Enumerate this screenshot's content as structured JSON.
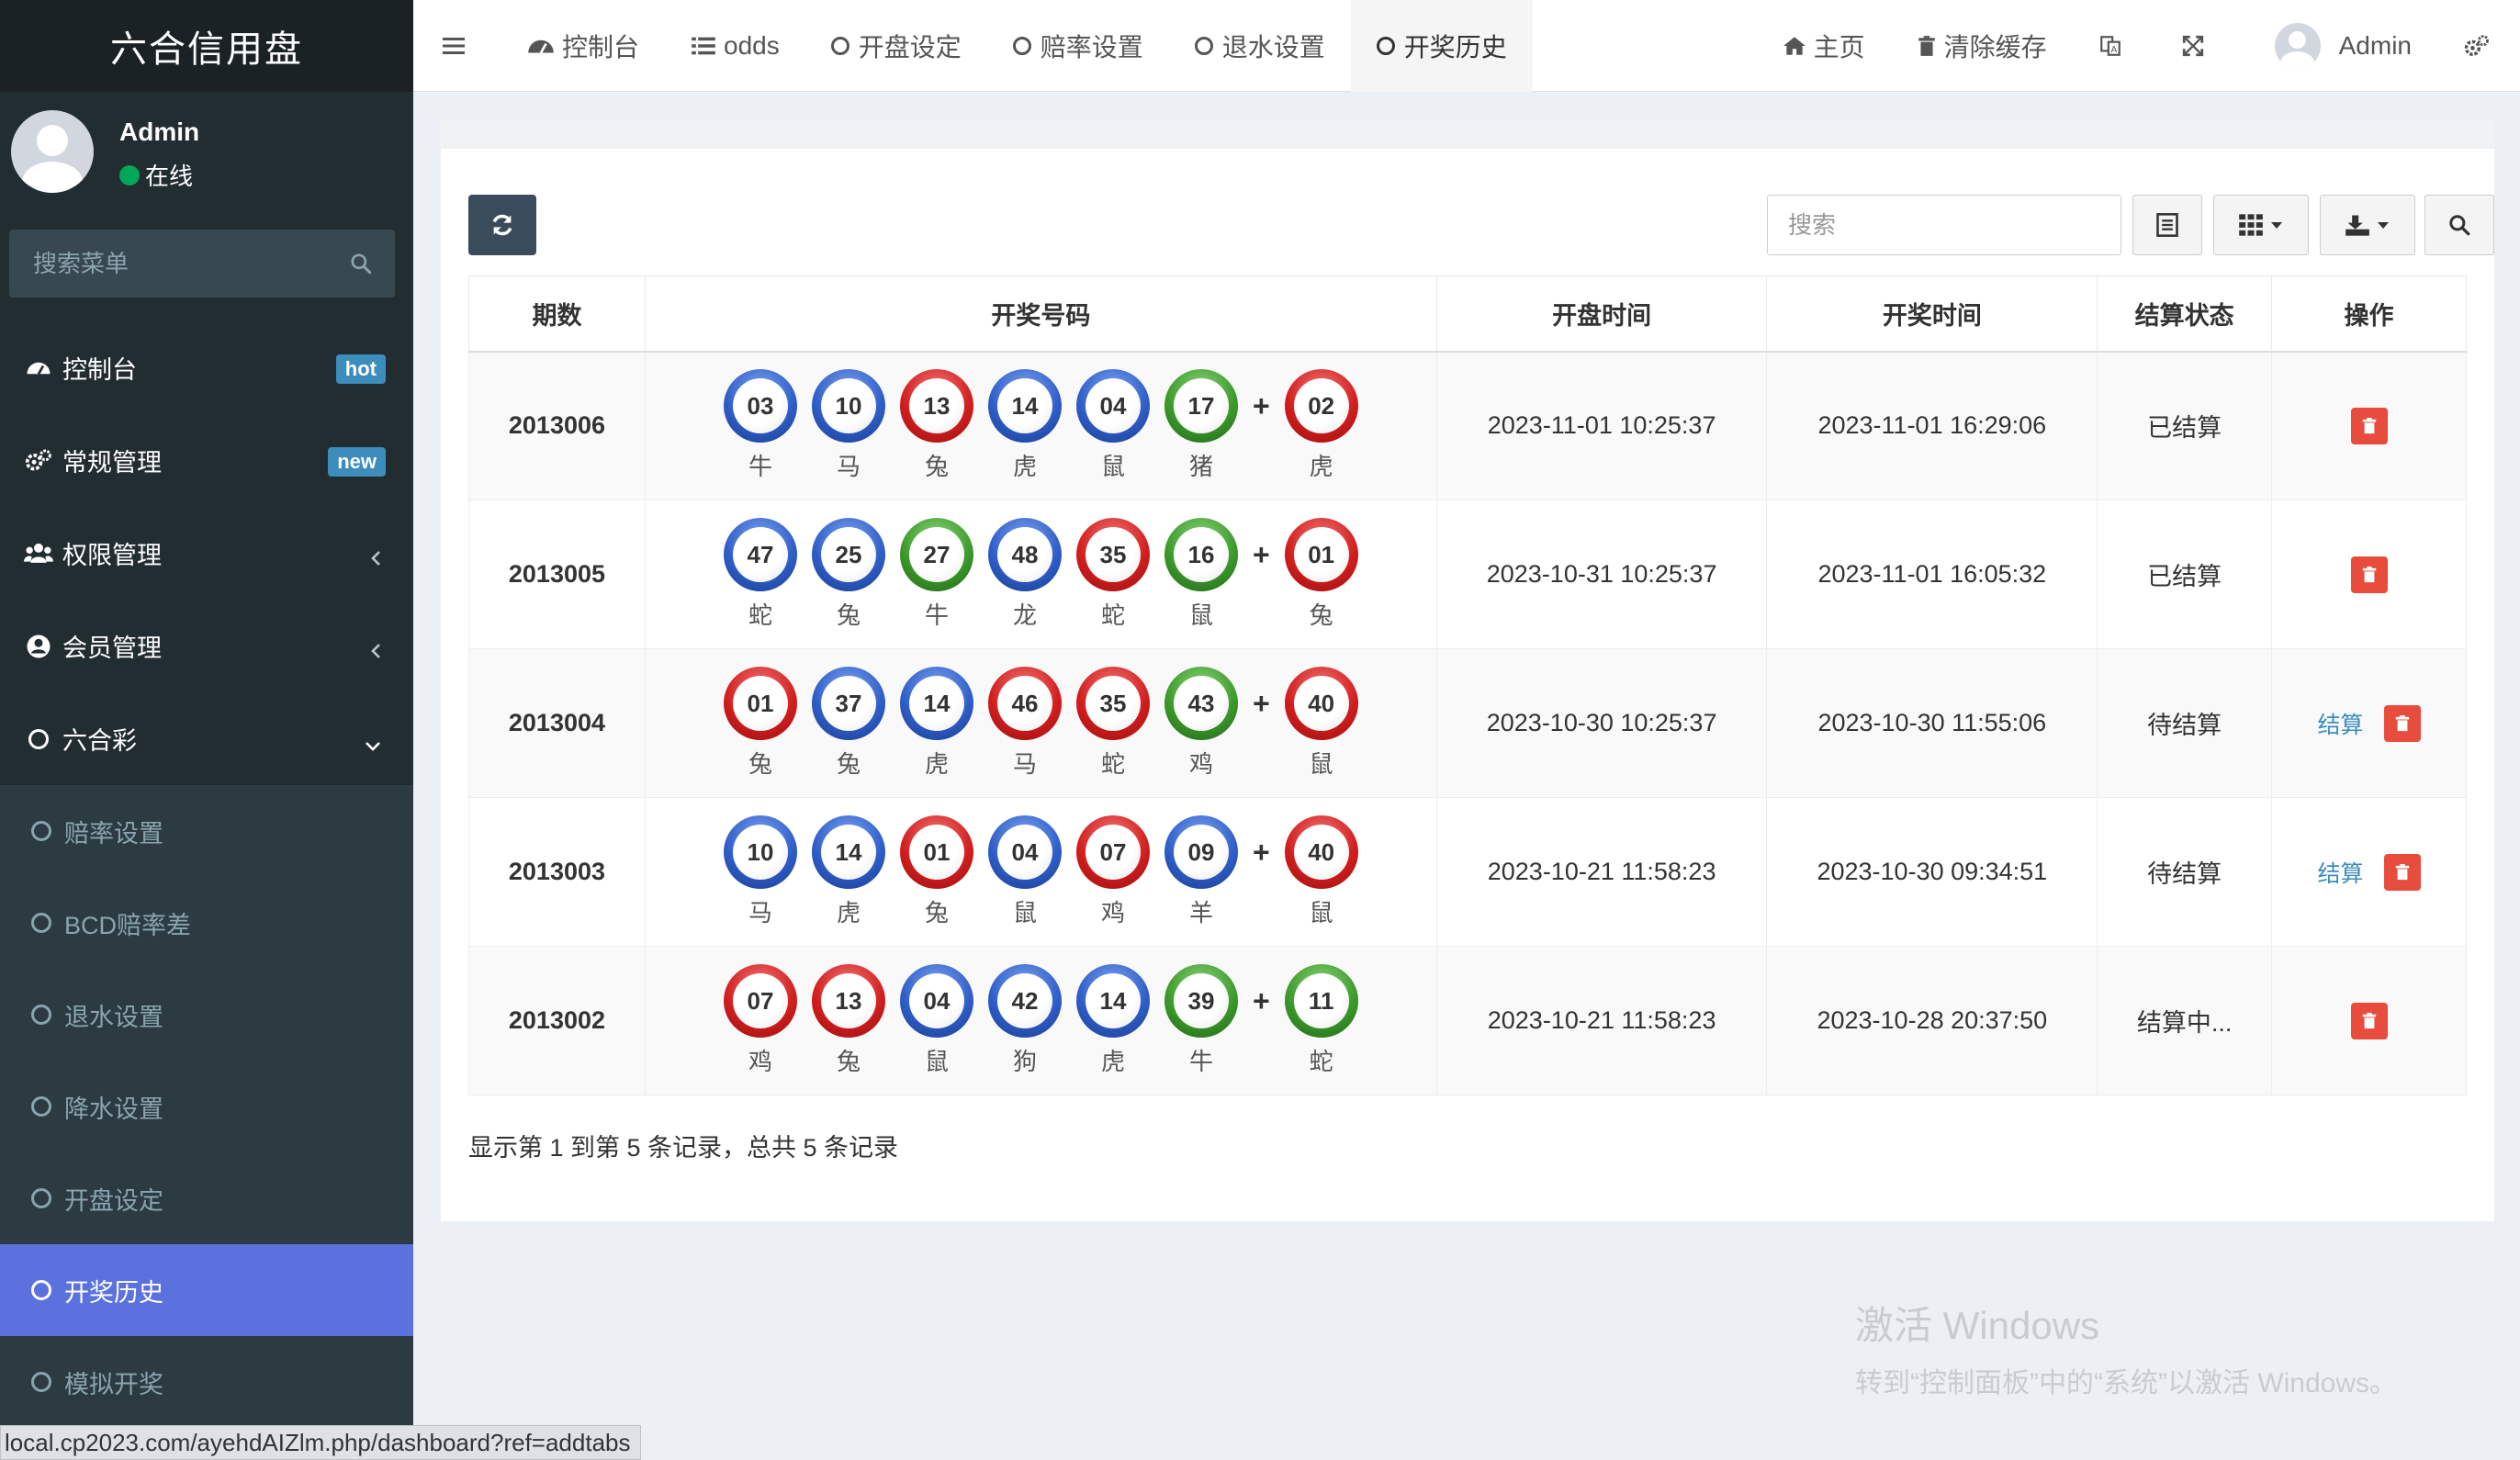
{
  "sidebar": {
    "brand": "六合信用盘",
    "user": {
      "name": "Admin",
      "status": "在线"
    },
    "search_placeholder": "搜索菜单",
    "menu": [
      {
        "label": "控制台",
        "badge": "hot",
        "badge_color": "#3c8dbc",
        "icon": "dashboard-icon"
      },
      {
        "label": "常规管理",
        "badge": "new",
        "badge_color": "#3c8dbc",
        "icon": "cogs-icon"
      },
      {
        "label": "权限管理",
        "icon": "users-icon"
      },
      {
        "label": "会员管理",
        "icon": "user-circle-icon"
      },
      {
        "label": "六合彩",
        "icon": "circle-icon",
        "expanded": true
      }
    ],
    "submenu": [
      {
        "label": "赔率设置"
      },
      {
        "label": "BCD赔率差"
      },
      {
        "label": "退水设置"
      },
      {
        "label": "降水设置"
      },
      {
        "label": "开盘设定"
      },
      {
        "label": "开奖历史",
        "active": true
      },
      {
        "label": "模拟开奖"
      }
    ],
    "active_color": "#5b72de"
  },
  "topbar": {
    "tabs": [
      {
        "label": "控制台",
        "icon": "dashboard-icon"
      },
      {
        "label": "odds",
        "icon": "list-icon"
      },
      {
        "label": "开盘设定",
        "icon": "circle-icon"
      },
      {
        "label": "赔率设置",
        "icon": "circle-icon"
      },
      {
        "label": "退水设置",
        "icon": "circle-icon"
      },
      {
        "label": "开奖历史",
        "icon": "circle-icon",
        "active": true
      }
    ],
    "right": {
      "home": "主页",
      "clear_cache": "清除缓存",
      "user": "Admin"
    }
  },
  "toolbar": {
    "search_placeholder": "搜索"
  },
  "table": {
    "headers": [
      "期数",
      "开奖号码",
      "开盘时间",
      "开奖时间",
      "结算状态",
      "操作"
    ],
    "settle_label": "结算",
    "rows": [
      {
        "period": "2013006",
        "balls": [
          {
            "num": "03",
            "zodiac": "牛",
            "color": "blue"
          },
          {
            "num": "10",
            "zodiac": "马",
            "color": "blue"
          },
          {
            "num": "13",
            "zodiac": "兔",
            "color": "red"
          },
          {
            "num": "14",
            "zodiac": "虎",
            "color": "blue"
          },
          {
            "num": "04",
            "zodiac": "鼠",
            "color": "blue"
          },
          {
            "num": "17",
            "zodiac": "猪",
            "color": "green"
          }
        ],
        "special": {
          "num": "02",
          "zodiac": "虎",
          "color": "red"
        },
        "open_time": "2023-11-01 10:25:37",
        "draw_time": "2023-11-01 16:29:06",
        "status": "已结算",
        "settle_action": false
      },
      {
        "period": "2013005",
        "balls": [
          {
            "num": "47",
            "zodiac": "蛇",
            "color": "blue"
          },
          {
            "num": "25",
            "zodiac": "兔",
            "color": "blue"
          },
          {
            "num": "27",
            "zodiac": "牛",
            "color": "green"
          },
          {
            "num": "48",
            "zodiac": "龙",
            "color": "blue"
          },
          {
            "num": "35",
            "zodiac": "蛇",
            "color": "red"
          },
          {
            "num": "16",
            "zodiac": "鼠",
            "color": "green"
          }
        ],
        "special": {
          "num": "01",
          "zodiac": "兔",
          "color": "red"
        },
        "open_time": "2023-10-31 10:25:37",
        "draw_time": "2023-11-01 16:05:32",
        "status": "已结算",
        "settle_action": false
      },
      {
        "period": "2013004",
        "balls": [
          {
            "num": "01",
            "zodiac": "兔",
            "color": "red"
          },
          {
            "num": "37",
            "zodiac": "兔",
            "color": "blue"
          },
          {
            "num": "14",
            "zodiac": "虎",
            "color": "blue"
          },
          {
            "num": "46",
            "zodiac": "马",
            "color": "red"
          },
          {
            "num": "35",
            "zodiac": "蛇",
            "color": "red"
          },
          {
            "num": "43",
            "zodiac": "鸡",
            "color": "green"
          }
        ],
        "special": {
          "num": "40",
          "zodiac": "鼠",
          "color": "red"
        },
        "open_time": "2023-10-30 10:25:37",
        "draw_time": "2023-10-30 11:55:06",
        "status": "待结算",
        "settle_action": true
      },
      {
        "period": "2013003",
        "balls": [
          {
            "num": "10",
            "zodiac": "马",
            "color": "blue"
          },
          {
            "num": "14",
            "zodiac": "虎",
            "color": "blue"
          },
          {
            "num": "01",
            "zodiac": "兔",
            "color": "red"
          },
          {
            "num": "04",
            "zodiac": "鼠",
            "color": "blue"
          },
          {
            "num": "07",
            "zodiac": "鸡",
            "color": "red"
          },
          {
            "num": "09",
            "zodiac": "羊",
            "color": "blue"
          }
        ],
        "special": {
          "num": "40",
          "zodiac": "鼠",
          "color": "red"
        },
        "open_time": "2023-10-21 11:58:23",
        "draw_time": "2023-10-30 09:34:51",
        "status": "待结算",
        "settle_action": true
      },
      {
        "period": "2013002",
        "balls": [
          {
            "num": "07",
            "zodiac": "鸡",
            "color": "red"
          },
          {
            "num": "13",
            "zodiac": "兔",
            "color": "red"
          },
          {
            "num": "04",
            "zodiac": "鼠",
            "color": "blue"
          },
          {
            "num": "42",
            "zodiac": "狗",
            "color": "blue"
          },
          {
            "num": "14",
            "zodiac": "虎",
            "color": "blue"
          },
          {
            "num": "39",
            "zodiac": "牛",
            "color": "green"
          }
        ],
        "special": {
          "num": "11",
          "zodiac": "蛇",
          "color": "green"
        },
        "open_time": "2023-10-21 11:58:23",
        "draw_time": "2023-10-28 20:37:50",
        "status": "结算中...",
        "settle_action": false
      }
    ]
  },
  "pagination_info": "显示第 1 到第 5 条记录，总共 5 条记录",
  "watermark": {
    "line1": "激活 Windows",
    "line2": "转到“控制面板”中的“系统”以激活 Windows。"
  },
  "status_url": "local.cp2023.com/ayehdAIZlm.php/dashboard?ref=addtabs"
}
